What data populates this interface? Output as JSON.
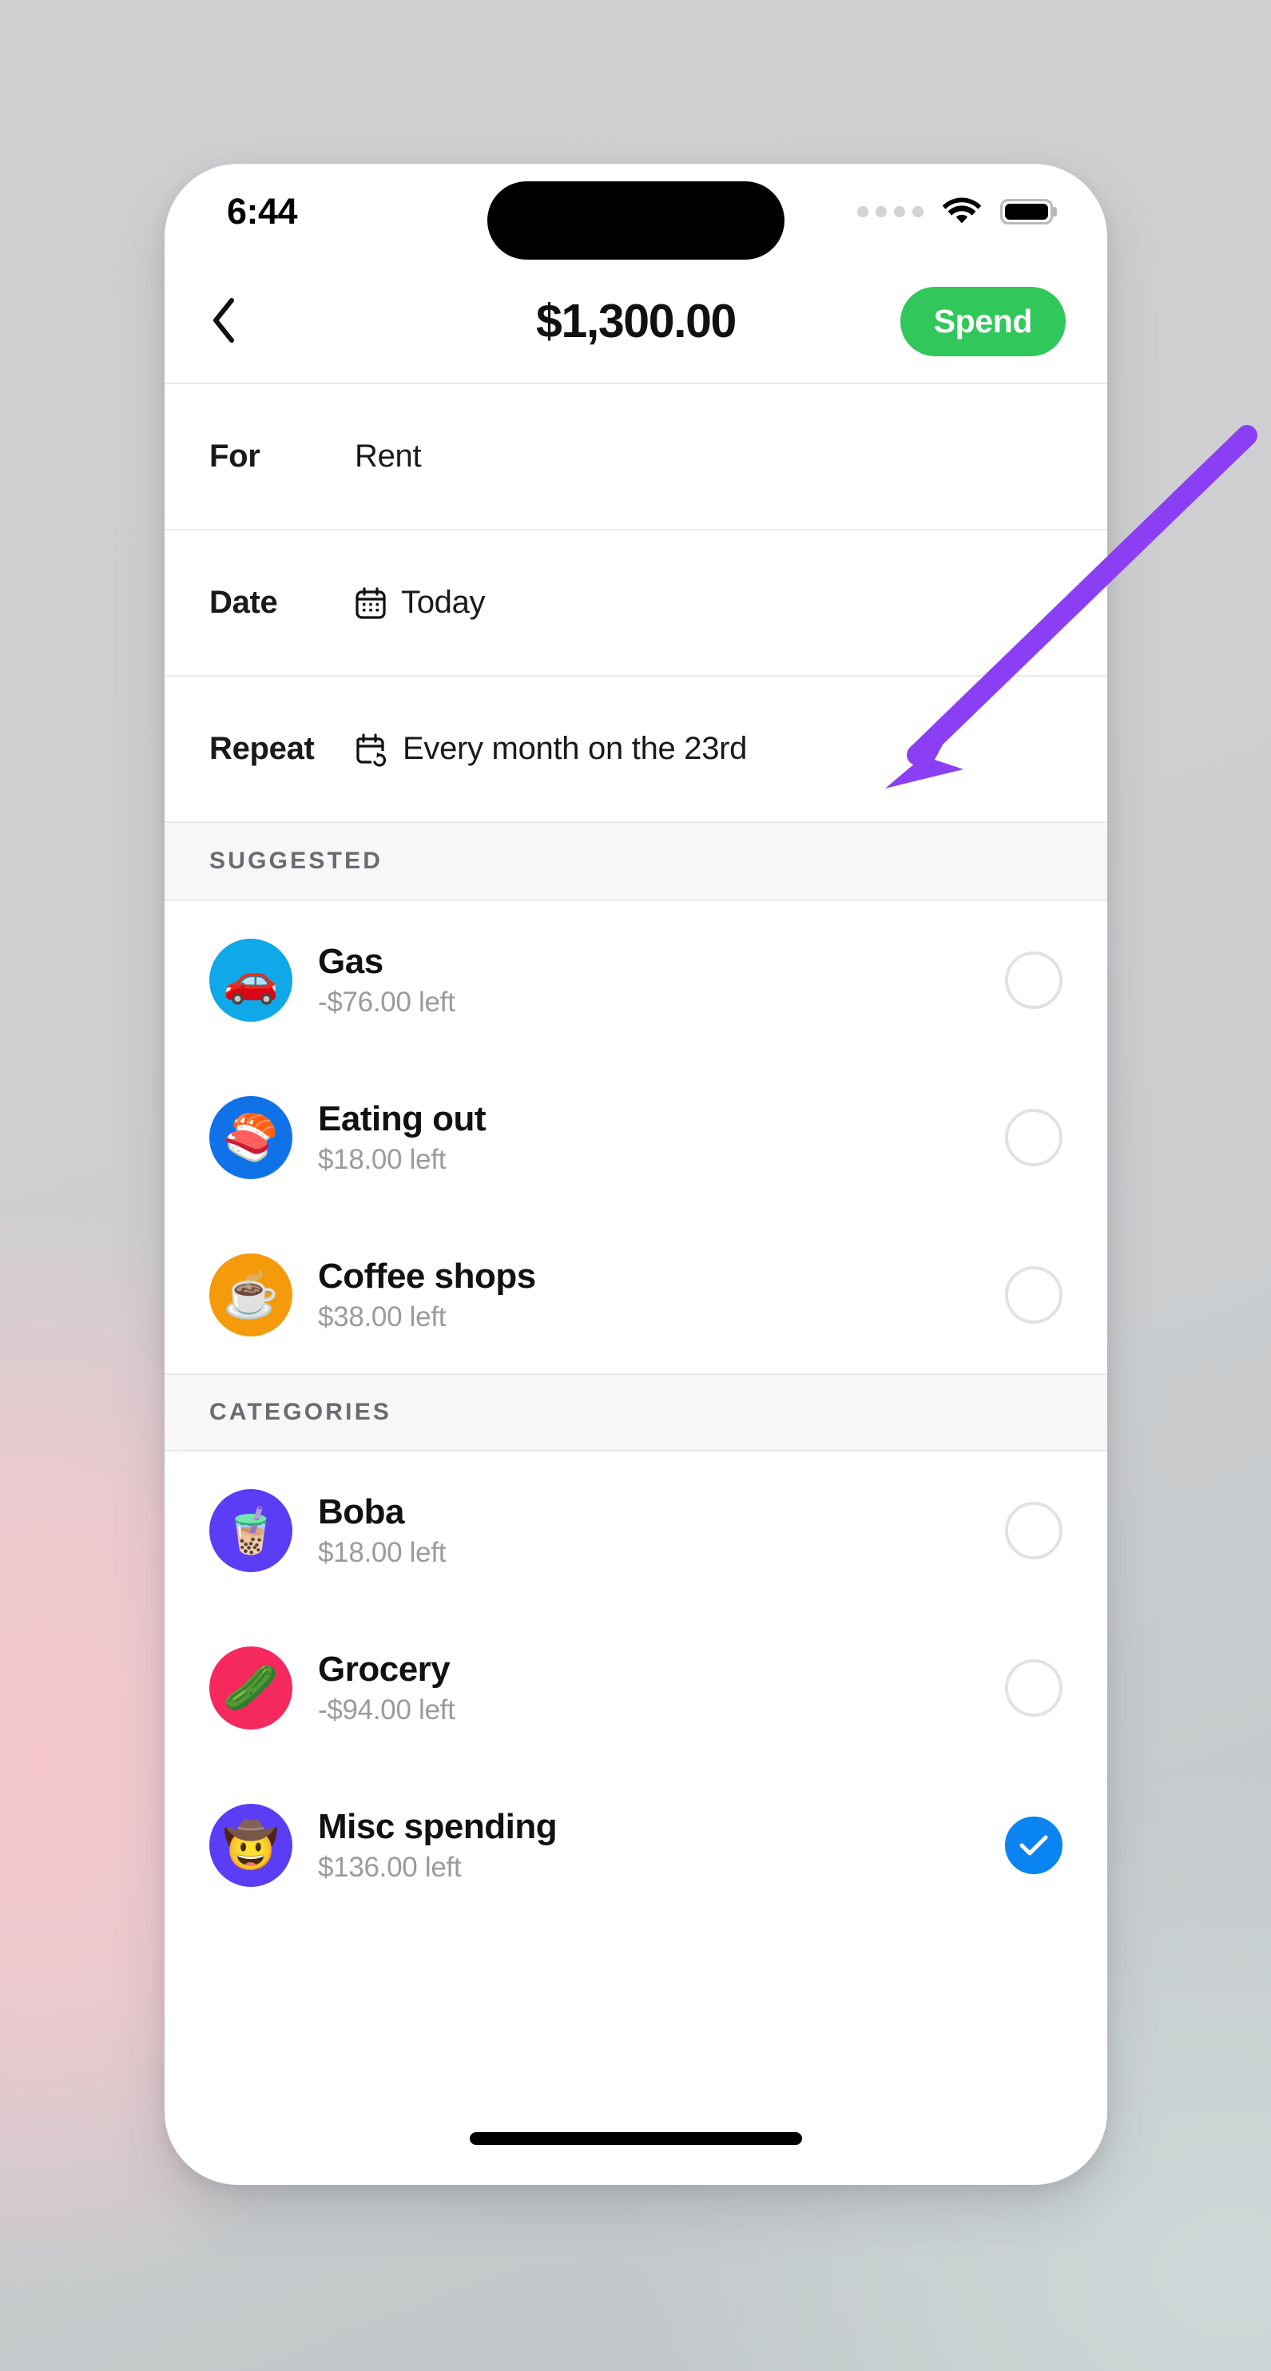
{
  "status_bar": {
    "time": "6:44",
    "signal_icon": "cellular-dots-icon",
    "wifi_icon": "wifi-icon",
    "battery_icon": "battery-full-icon"
  },
  "nav_bar": {
    "back_icon": "chevron-left-icon",
    "title": "$1,300.00",
    "action_label": "Spend",
    "action_color": "#31c75a"
  },
  "details": [
    {
      "label": "For",
      "value": "Rent",
      "icon": ""
    },
    {
      "label": "Date",
      "value": "Today",
      "icon": "calendar-icon"
    },
    {
      "label": "Repeat",
      "value": "Every month on the 23rd",
      "icon": "calendar-repeat-icon"
    }
  ],
  "sections": [
    {
      "header": "SUGGESTED",
      "items": [
        {
          "name": "Gas",
          "amount": "-$76.00 left",
          "emoji": "🚗",
          "emoji_name": "car-emoji",
          "bg": "#0fa8e8",
          "selected": false
        },
        {
          "name": "Eating out",
          "amount": "$18.00 left",
          "emoji": "🍣",
          "emoji_name": "sushi-emoji",
          "bg": "#0f72e8",
          "selected": false
        },
        {
          "name": "Coffee shops",
          "amount": "$38.00 left",
          "emoji": "☕",
          "emoji_name": "coffee-emoji",
          "bg": "#f59b0b",
          "selected": false
        }
      ]
    },
    {
      "header": "CATEGORIES",
      "items": [
        {
          "name": "Boba",
          "amount": "$18.00 left",
          "emoji": "🧋",
          "emoji_name": "bubble-tea-emoji",
          "bg": "#5b3df5",
          "selected": false
        },
        {
          "name": "Grocery",
          "amount": "-$94.00 left",
          "emoji": "🥒",
          "emoji_name": "cucumber-emoji",
          "bg": "#f5295e",
          "selected": false
        },
        {
          "name": "Misc spending",
          "amount": "$136.00 left",
          "emoji": "🤠",
          "emoji_name": "cowboy-emoji",
          "bg": "#5b3df5",
          "selected": true
        }
      ]
    }
  ],
  "annotation": {
    "arrow_color": "#8b3ff5",
    "points_at": "Repeat"
  },
  "home_indicator": "home-indicator"
}
